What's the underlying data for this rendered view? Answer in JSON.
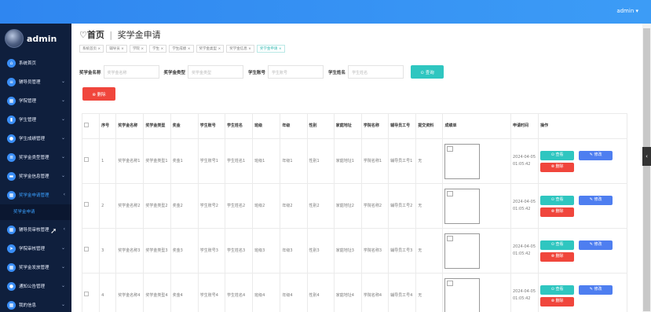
{
  "header": {
    "user_label": "admin ▾"
  },
  "sidebar": {
    "admin_name": "admin",
    "items": [
      {
        "label": "系统首页",
        "icon": "home-icon",
        "glyph": "⌂",
        "chev": ""
      },
      {
        "label": "辅导员管理",
        "icon": "list-icon",
        "glyph": "≡",
        "chev": "⌄"
      },
      {
        "label": "学院管理",
        "icon": "grid-icon",
        "glyph": "▦",
        "chev": "⌄"
      },
      {
        "label": "学生管理",
        "icon": "chart-icon",
        "glyph": "▮",
        "chev": "⌄"
      },
      {
        "label": "学生成绩管理",
        "icon": "user-icon",
        "glyph": "●",
        "chev": "⌄"
      },
      {
        "label": "奖学金类型管理",
        "icon": "sliders-icon",
        "glyph": "≣",
        "chev": "⌄"
      },
      {
        "label": "奖学金信息管理",
        "icon": "message-icon",
        "glyph": "▬",
        "chev": "⌄"
      },
      {
        "label": "奖学金申请管理",
        "icon": "grid-icon",
        "glyph": "▦",
        "chev": "‹"
      },
      {
        "label": "辅导员审核管理",
        "icon": "grid-icon",
        "glyph": "▦",
        "chev": "‹"
      },
      {
        "label": "学院审核管理",
        "icon": "send-icon",
        "glyph": "➤",
        "chev": "⌄"
      },
      {
        "label": "奖学金发放管理",
        "icon": "grid-icon",
        "glyph": "▦",
        "chev": "⌄"
      },
      {
        "label": "通知公告管理",
        "icon": "user-icon",
        "glyph": "●",
        "chev": "⌄"
      },
      {
        "label": "我的信息",
        "icon": "grid-icon",
        "glyph": "▦",
        "chev": "⌄"
      }
    ],
    "submenu_label": "奖学金申请"
  },
  "breadcrumb": {
    "home": "♡首页",
    "sep": "|",
    "current": "奖学金申请"
  },
  "tags": [
    "系统首页 ×",
    "辅导员 ×",
    "学院 ×",
    "学生 ×",
    "学生成绩 ×",
    "奖学金类型 ×",
    "奖学金信息 ×",
    "奖学金申请 ×"
  ],
  "filters": {
    "name_label": "奖学金名称",
    "name_placeholder": "奖学金名称",
    "type_label": "奖学金类型",
    "type_placeholder": "奖学金类型",
    "account_label": "学生账号",
    "account_placeholder": "学生账号",
    "student_label": "学生姓名",
    "student_placeholder": "学生姓名",
    "search_button": "⊙ 查询"
  },
  "delete_button": "⊗ 删除",
  "table": {
    "headers": [
      "",
      "序号",
      "奖学金名称",
      "奖学金类型",
      "奖金",
      "学生账号",
      "学生姓名",
      "班级",
      "年级",
      "性别",
      "家庭地址",
      "学院名称",
      "辅导员工号",
      "提交资料",
      "成绩单",
      "申请时间",
      "操作"
    ],
    "rows": [
      {
        "no": "1",
        "name": "奖学金名称1",
        "type": "奖学金类型1",
        "bonus": "奖金1",
        "account": "学生账号1",
        "student": "学生姓名1",
        "class": "班级1",
        "grade": "年级1",
        "gender": "性别1",
        "address": "家庭地址1",
        "college": "学院名称1",
        "counselor": "辅导员工号1",
        "material": "无",
        "time": "2024-04-05 01:05:42"
      },
      {
        "no": "2",
        "name": "奖学金名称2",
        "type": "奖学金类型2",
        "bonus": "奖金2",
        "account": "学生账号2",
        "student": "学生姓名2",
        "class": "班级2",
        "grade": "年级2",
        "gender": "性别2",
        "address": "家庭地址2",
        "college": "学院名称2",
        "counselor": "辅导员工号2",
        "material": "无",
        "time": "2024-04-05 01:05:42"
      },
      {
        "no": "3",
        "name": "奖学金名称3",
        "type": "奖学金类型3",
        "bonus": "奖金3",
        "account": "学生账号3",
        "student": "学生姓名3",
        "class": "班级3",
        "grade": "年级3",
        "gender": "性别3",
        "address": "家庭地址3",
        "college": "学院名称3",
        "counselor": "辅导员工号3",
        "material": "无",
        "time": "2024-04-05 01:05:42"
      },
      {
        "no": "4",
        "name": "奖学金名称4",
        "type": "奖学金类型4",
        "bonus": "奖金4",
        "account": "学生账号4",
        "student": "学生姓名4",
        "class": "班级4",
        "grade": "年级4",
        "gender": "性别4",
        "address": "家庭地址4",
        "college": "学院名称4",
        "counselor": "辅导员工号4",
        "material": "无",
        "time": "2024-04-05 01:05:42"
      }
    ],
    "actions": {
      "view": "⊙ 查看",
      "edit": "✎ 修改",
      "delete": "⊗ 删除"
    }
  },
  "side_tab_glyph": "‹"
}
